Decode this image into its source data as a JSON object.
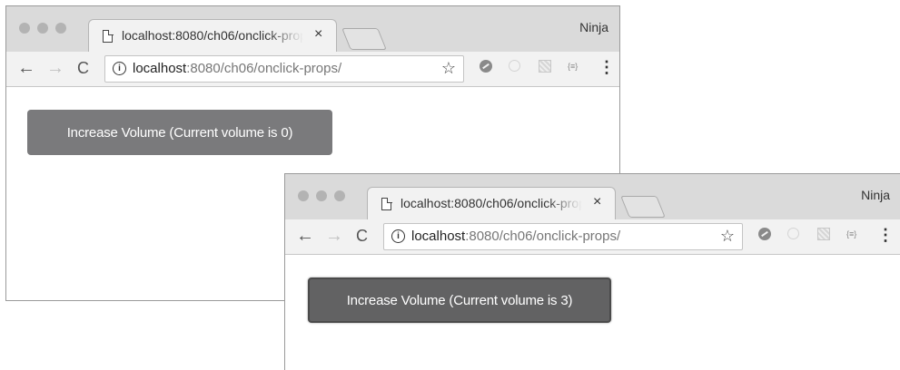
{
  "windows": [
    {
      "tab_title": "localhost:8080/ch06/onclick-props/",
      "tab_close": "×",
      "profile": "Ninja",
      "url_host": "localhost",
      "url_path": ":8080/ch06/onclick-props/",
      "button_label": "Increase Volume (Current volume is 0)"
    },
    {
      "tab_title": "localhost:8080/ch06/onclick-props/",
      "tab_close": "×",
      "profile": "Ninja",
      "url_host": "localhost",
      "url_path": ":8080/ch06/onclick-props/",
      "button_label": "Increase Volume (Current volume is 3)"
    }
  ],
  "icons": {
    "back": "←",
    "forward": "→",
    "reload": "C",
    "info": "i",
    "star": "☆",
    "extension_4": "{≡}",
    "menu": "⋮"
  },
  "colors": {
    "button_default": "#7a7a7c",
    "button_active": "#626263"
  }
}
